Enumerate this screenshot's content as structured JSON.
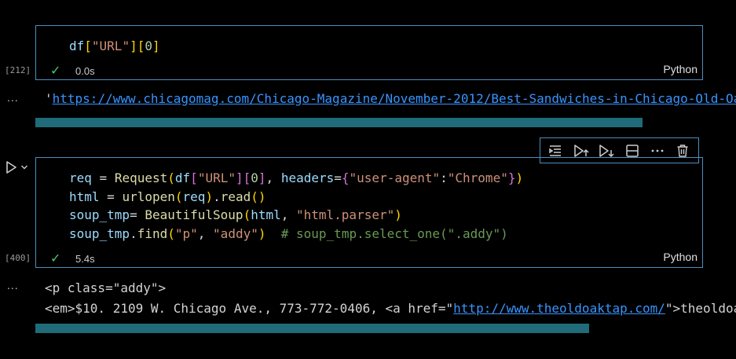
{
  "cell1": {
    "exec_count": "[212]",
    "code": [
      "df[\"URL\"][0]"
    ],
    "duration": "0.0s",
    "language": "Python",
    "output_prefix": "'",
    "output_url": "https://www.chicagomag.com/Chicago-Magazine/November-2012/Best-Sandwiches-in-Chicago-Old-Oak-Tap-BLT/"
  },
  "cell2": {
    "exec_count": "[400]",
    "duration": "5.4s",
    "language": "Python",
    "output_line1": "<p class=\"addy\">",
    "output_line2_prefix": "<em>$10. 2109 W. Chicago Ave., 773-772-0406, <a href=\"",
    "output_line2_link": "http://www.theoldoaktap.com/",
    "output_line2_suffix": "\">theoldoaktap.com</a></em>"
  },
  "ellipsis": "...",
  "toolbar": {
    "items": [
      "execute-above-icon",
      "run-above-icon",
      "run-below-icon",
      "split-cell-icon",
      "more-icon",
      "delete-icon"
    ]
  },
  "colors": {
    "border": "#4a8fbf",
    "scrollbar": "#1f6b7a",
    "check": "#4ec96a"
  }
}
